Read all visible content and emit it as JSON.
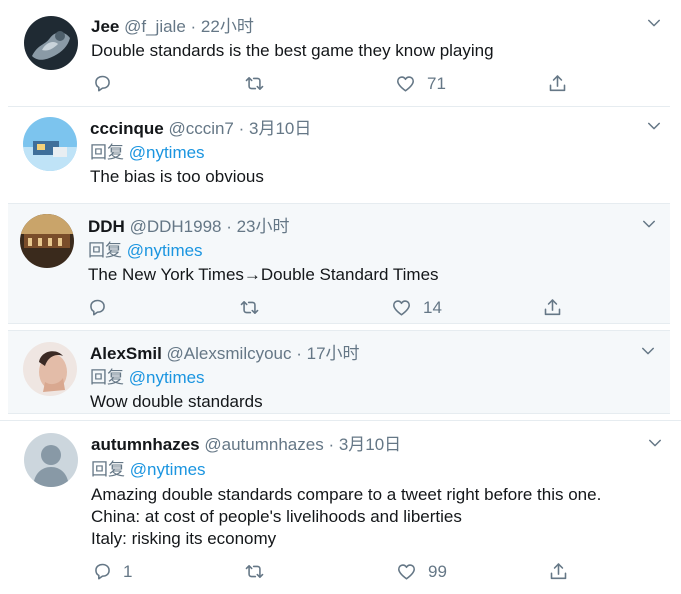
{
  "tweets": [
    {
      "name": "Jee",
      "handle": "@f_jiale",
      "time": "· 22小时",
      "text_lines": [
        "Double standards is the best game they know playing"
      ],
      "likes": "71"
    },
    {
      "name": "cccinque",
      "handle": "@cccin7",
      "time": "· 3月10日",
      "reply_prefix": "回复",
      "reply_to": "@nytimes",
      "text_lines": [
        "The bias is too obvious"
      ]
    },
    {
      "name": "DDH",
      "handle": "@DDH1998",
      "time": "· 23小时",
      "reply_prefix": "回复",
      "reply_to": "@nytimes",
      "text_lines": [
        "The New York Times→Double Standard Times"
      ],
      "likes": "14"
    },
    {
      "name": "AlexSmil",
      "handle": "@Alexsmilcyouc",
      "time": "· 17小时",
      "reply_prefix": "回复",
      "reply_to": "@nytimes",
      "text_lines": [
        "Wow double standards"
      ]
    },
    {
      "name": "autumnhazes",
      "handle": "@autumnhazes",
      "time": "· 3月10日",
      "reply_prefix": "回复",
      "reply_to": "@nytimes",
      "text_lines": [
        "Amazing double standards compare to a tweet right before this one.",
        "China: at cost of people's livelihoods and liberties",
        "Italy: risking its economy"
      ],
      "replies": "1",
      "likes": "99"
    }
  ],
  "colors": {
    "text": "#14171a",
    "secondary": "#657786",
    "mention": "#1b95e0",
    "highlight_bg": "#f5f8fa"
  },
  "icons": [
    "reply-icon",
    "retweet-icon",
    "like-icon",
    "share-icon",
    "chevron-down-icon"
  ]
}
